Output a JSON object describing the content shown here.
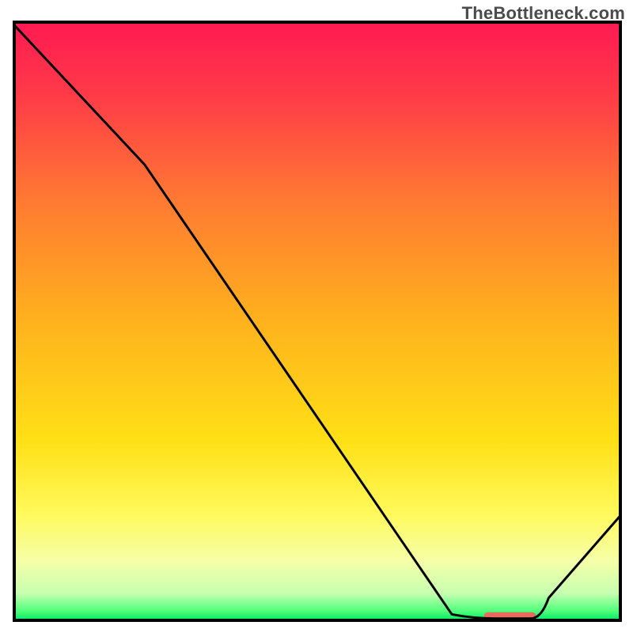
{
  "watermark": {
    "text": "TheBottleneck.com"
  },
  "palette": {
    "frame": "#000000",
    "curve": "#000000",
    "marker": "#e7695f",
    "gradient_stops": [
      {
        "offset": 0.0,
        "color": "#ff1a52"
      },
      {
        "offset": 0.12,
        "color": "#ff3a48"
      },
      {
        "offset": 0.3,
        "color": "#ff7a32"
      },
      {
        "offset": 0.5,
        "color": "#ffb21d"
      },
      {
        "offset": 0.7,
        "color": "#ffe016"
      },
      {
        "offset": 0.82,
        "color": "#fff95a"
      },
      {
        "offset": 0.9,
        "color": "#f6ffa7"
      },
      {
        "offset": 0.955,
        "color": "#c7ffb0"
      },
      {
        "offset": 0.985,
        "color": "#4dff7a"
      },
      {
        "offset": 1.0,
        "color": "#00e865"
      }
    ]
  },
  "chart_data": {
    "type": "line",
    "title": "",
    "xlabel": "",
    "ylabel": "",
    "xlim": [
      0,
      100
    ],
    "ylim": [
      0,
      100
    ],
    "grid": false,
    "legend": false,
    "series": [
      {
        "name": "bottleneck-curve",
        "x": [
          0.0,
          21.5,
          72.2,
          79.4,
          85.2,
          100.0
        ],
        "y": [
          99.5,
          76.2,
          1.0,
          0.3,
          0.3,
          17.5
        ]
      }
    ],
    "marker": {
      "name": "optimal-marker",
      "x_center": 81.8,
      "half_width": 4.3,
      "y": 0.7,
      "thickness_px": 10,
      "color": "#e7695f"
    }
  }
}
